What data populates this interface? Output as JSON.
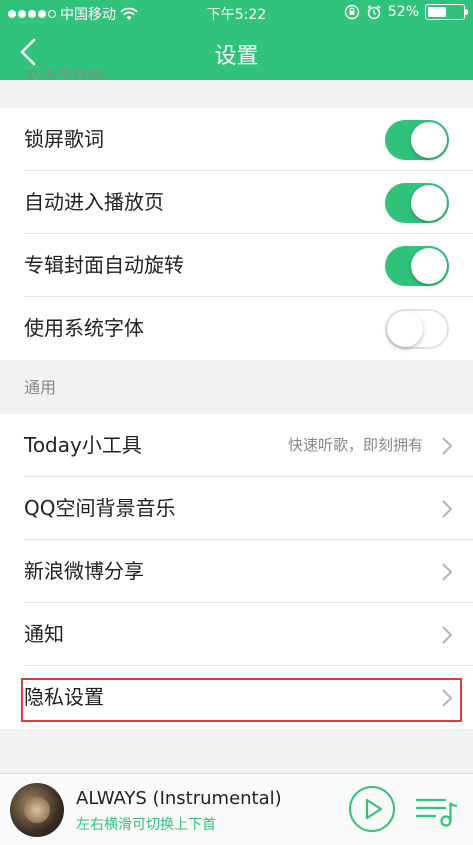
{
  "status_bar": {
    "carrier": "中国移动",
    "time": "下午5:22",
    "battery_text": "52%",
    "battery_level": 0.52,
    "signal_dots_filled": 4,
    "icons": [
      "signal-dots-icon",
      "wifi-icon",
      "rotation-lock-icon",
      "alarm-icon",
      "battery-icon"
    ]
  },
  "nav": {
    "title": "设置",
    "back_icon": "chevron-left-icon"
  },
  "sections": {
    "lyrics": {
      "header": "歌词与界面",
      "items": [
        {
          "label": "锁屏歌词",
          "toggle": true
        },
        {
          "label": "自动进入播放页",
          "toggle": true
        },
        {
          "label": "专辑封面自动旋转",
          "toggle": true
        },
        {
          "label": "使用系统字体",
          "toggle": false
        }
      ]
    },
    "general": {
      "header": "通用",
      "items": [
        {
          "label": "Today小工具",
          "sub": "快速听歌，即刻拥有"
        },
        {
          "label": "QQ空间背景音乐"
        },
        {
          "label": "新浪微博分享"
        },
        {
          "label": "通知"
        },
        {
          "label": "隐私设置"
        }
      ]
    }
  },
  "player": {
    "song_title": "ALWAYS (Instrumental)",
    "hint": "左右横滑可切换上下首"
  },
  "colors": {
    "accent": "#31c27c",
    "highlight": "#e03a3a",
    "background": "#f2f2f2"
  }
}
